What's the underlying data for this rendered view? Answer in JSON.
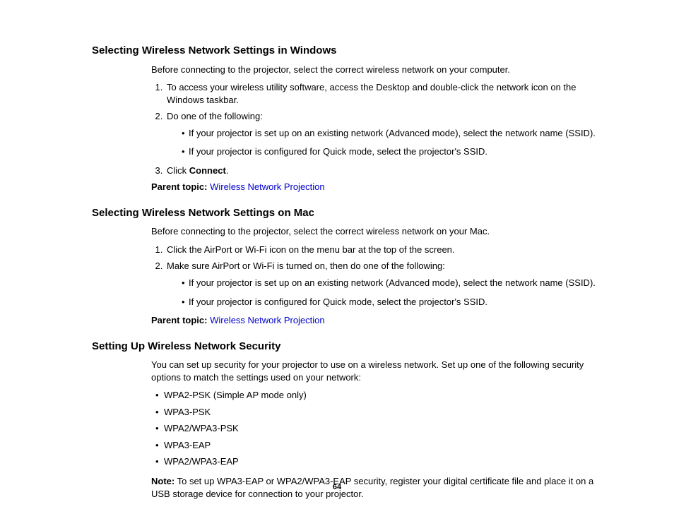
{
  "page_number": "64",
  "sections": [
    {
      "heading": "Selecting Wireless Network Settings in Windows",
      "intro": "Before connecting to the projector, select the correct wireless network on your computer.",
      "steps": [
        {
          "text": "To access your wireless utility software, access the Desktop and double-click the network icon on the Windows taskbar."
        },
        {
          "text": "Do one of the following:",
          "sub": [
            "If your projector is set up on an existing network (Advanced mode), select the network name (SSID).",
            "If your projector is configured for Quick mode, select the projector's SSID."
          ]
        },
        {
          "text_pre": "Click ",
          "bold": "Connect",
          "text_post": "."
        }
      ],
      "parent_label": "Parent topic:",
      "parent_link": "Wireless Network Projection"
    },
    {
      "heading": "Selecting Wireless Network Settings on Mac",
      "intro": "Before connecting to the projector, select the correct wireless network on your Mac.",
      "steps": [
        {
          "text": "Click the AirPort or Wi-Fi icon on the menu bar at the top of the screen."
        },
        {
          "text": "Make sure AirPort or Wi-Fi is turned on, then do one of the following:",
          "sub": [
            "If your projector is set up on an existing network (Advanced mode), select the network name (SSID).",
            "If your projector is configured for Quick mode, select the projector's SSID."
          ]
        }
      ],
      "parent_label": "Parent topic:",
      "parent_link": "Wireless Network Projection"
    },
    {
      "heading": "Setting Up Wireless Network Security",
      "intro": "You can set up security for your projector to use on a wireless network. Set up one of the following security options to match the settings used on your network:",
      "bullets": [
        "WPA2-PSK (Simple AP mode only)",
        "WPA3-PSK",
        "WPA2/WPA3-PSK",
        "WPA3-EAP",
        "WPA2/WPA3-EAP"
      ],
      "note_label": "Note:",
      "note_text": " To set up WPA3-EAP or WPA2/WPA3-EAP security, register your digital certificate file and place it on a USB storage device for connection to your projector."
    }
  ]
}
